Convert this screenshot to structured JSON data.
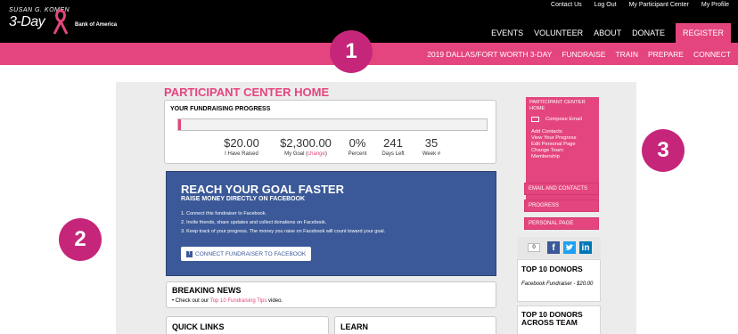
{
  "header": {
    "logo_line1": "SUSAN G. KOMEN",
    "logo_line2": "3-Day",
    "sponsor": "Bank of America",
    "utility_nav": [
      "Contact Us",
      "Log Out",
      "My Participant Center",
      "My Profile"
    ],
    "main_nav": [
      "EVENTS",
      "VOLUNTEER",
      "ABOUT",
      "DONATE"
    ],
    "register_label": "REGISTER",
    "sub_nav": [
      "2019 DALLAS/FORT WORTH 3-DAY",
      "FUNDRAISE",
      "TRAIN",
      "PREPARE",
      "CONNECT"
    ]
  },
  "callouts": [
    "1",
    "2",
    "3"
  ],
  "page_title": "PARTICIPANT CENTER HOME",
  "progress": {
    "heading": "YOUR FUNDRAISING PROGRESS",
    "fraction": 0.009,
    "stats": [
      {
        "value": "$20.00",
        "label": "I Have Raised"
      },
      {
        "value": "$2,300.00",
        "label": "My Goal (",
        "link": "change",
        "label_end": ")"
      },
      {
        "value": "0%",
        "label": "Percent"
      },
      {
        "value": "241",
        "label": "Days Left"
      },
      {
        "value": "35",
        "label": "Week #"
      }
    ]
  },
  "facebook": {
    "heading": "REACH YOUR GOAL FASTER",
    "subheading": "RAISE MONEY DIRECTLY ON FACEBOOK",
    "steps": [
      "1. Connect this fundraiser to Facebook.",
      "2. Invite friends, share updates and collect donations on Facebook.",
      "3. Keep track of your progress. The money you raise on Facebook will count toward your goal."
    ],
    "button_label": "CONNECT FUNDRAISER TO FACEBOOK"
  },
  "breaking_news": {
    "heading": "BREAKING NEWS",
    "text_before": "• Check out our ",
    "link": "Top 10 Fundraising Tips",
    "text_after": " video."
  },
  "quick_links": {
    "heading": "QUICK LINKS"
  },
  "learn": {
    "heading": "LEARN"
  },
  "sidebar": {
    "title": "PARTICIPANT CENTER HOME",
    "compose": "Compose Email",
    "links": [
      "Add Contacts",
      "View Your Progress",
      "Edit Personal Page",
      "Change Team Membership"
    ],
    "sections": [
      "EMAIL AND CONTACTS",
      "PROGRESS",
      "PERSONAL PAGE"
    ],
    "social_count": "0",
    "top_donors": {
      "heading": "TOP 10 DONORS",
      "entry": "Facebook Fundraiser - $20.00"
    },
    "top_team": {
      "heading": "TOP 10 DONORS ACROSS TEAM"
    }
  },
  "colors": {
    "brand_pink": "#e4457e",
    "callout": "#c6267a",
    "facebook_blue": "#3b5998",
    "twitter_blue": "#1da1f2",
    "linkedin_blue": "#0077b5"
  }
}
